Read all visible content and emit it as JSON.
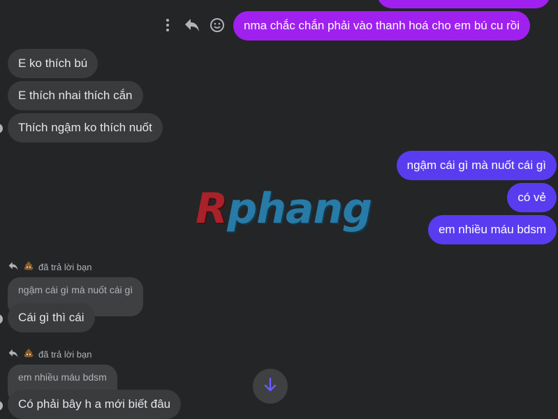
{
  "colors": {
    "background": "#242526",
    "incoming_bubble": "#3a3b3c",
    "quoted_bubble": "#3e4042",
    "outgoing_purple": "#a020f0",
    "outgoing_violet": "#5a3cf0"
  },
  "messages": {
    "top_out": "nma chắc chắn phải vào thanh hoá cho em bú cu rồi",
    "in_1": "E ko thích bú",
    "in_2": "E thích nhai thích cắn",
    "in_3": "Thích ngậm ko thích nuốt",
    "out_1": "ngậm cái gì mà nuốt cái gì",
    "out_2": "có vẻ",
    "out_3": "em nhiều máu bdsm",
    "reply1": {
      "meta": "đã trả lời bạn",
      "quoted": "ngậm cái gì mà nuốt cái gì",
      "text": "Cái gì thì cái"
    },
    "reply2": {
      "meta": "đã trả lời bạn",
      "quoted": "em nhiều máu bdsm",
      "text": "Có phải bây h a mới biết đâu"
    }
  },
  "watermark": {
    "first": "R",
    "rest": "phang"
  },
  "icons": {
    "more": "more-vertical-icon",
    "reply": "reply-arrow-icon",
    "react": "smiley-icon",
    "poop": "poop-emoji-icon",
    "scroll": "arrow-down-icon"
  }
}
